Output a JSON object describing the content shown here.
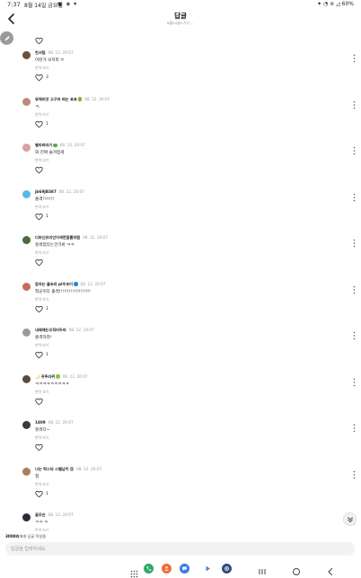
{
  "status_bar": {
    "time": "7:37",
    "date": "8월 14일 금요일",
    "battery": "60%"
  },
  "header": {
    "title": "답글",
    "subtitle": "8월14일8 기기 ..."
  },
  "comments": [
    {
      "user": "헌서팀",
      "date": "08. 12. 20:07",
      "text": "이런거 보지마 ㅠ",
      "translate": "번역 보기",
      "likes": "3",
      "avatar_color": "#6b4f3a",
      "badge": null
    },
    {
      "user": "뮤체비앗 고구마 찌는 표표",
      "date": "08. 12. 20:07",
      "text": "ㅋ,",
      "translate": "번역 보기",
      "likes": "1",
      "avatar_color": "#b98b7a",
      "badge": "#7cb342"
    },
    {
      "user": "별라바라기",
      "date": "08. 12. 20:07",
      "text": "와 진짜 슬겨첩게",
      "translate": "번역 보기",
      "likes": "",
      "avatar_color": "#d8a0a0",
      "badge": "#4caf50"
    },
    {
      "user": "jb69JB387",
      "date": "08. 12. 20:07",
      "text": "출격!!!!!!!",
      "translate": "번역 보기",
      "likes": "1",
      "avatar_color": "#5bb8e8",
      "badge": null
    },
    {
      "user": "디바신유리인어색한알름처럼",
      "date": "08. 12. 20:07",
      "text": "못씌었다는건가바 ㅋㅋ",
      "translate": "번역 보기",
      "likes": "",
      "avatar_color": "#4a6b3a",
      "badge": null
    },
    {
      "user": "잠자는 출속의 pl우초이",
      "date": "08. 12. 20:07",
      "text": "착군이다 출격!!!!!!!!!!!!!!!!!!!",
      "translate": "번역 보기",
      "likes": "1",
      "avatar_color": "#c96a5a",
      "badge": "#1e88e5"
    },
    {
      "user": "내배제는오직터두라",
      "date": "08. 12. 20:07",
      "text": "출격하라!",
      "translate": "번역 보기",
      "likes": "1",
      "avatar_color": "#9a9a9a",
      "badge": null
    },
    {
      "user": "🌙 귀뚜라뀌",
      "date": "08. 12. 20:07",
      "text": "ㅋㅋㅋㅋㅋㅋㅋㅋㅋ",
      "translate": "번역 보기",
      "likes": "",
      "avatar_color": "#5a4a3a",
      "badge": "#8bc34a"
    },
    {
      "user": "1409",
      "date": "08. 12. 20:07",
      "text": "못씌다~",
      "translate": "번역 보기",
      "likes": "",
      "avatar_color": "#3a3a3a",
      "badge": null
    },
    {
      "user": "나는 락스타 스텔남이",
      "date": "08. 12. 20:07",
      "text": "칠",
      "translate": "번역 보기",
      "likes": "1",
      "avatar_color": "#a88060",
      "badge": "#9e9e9e"
    },
    {
      "user": "골무은",
      "date": "08. 12. 20:07",
      "text": "ㅋㅋ ㅋ",
      "translate": "번역 보기",
      "likes": "",
      "avatar_color": "#2a2a3a",
      "badge": null
    }
  ],
  "reply": {
    "target_user": "3000리",
    "target_suffix": "에게 답글 작성중",
    "placeholder": "답글을 입력하세요."
  },
  "nav": {
    "apps": [
      {
        "name": "phone-app-icon",
        "color": "#2eaa6a"
      },
      {
        "name": "contacts-app-icon",
        "color": "#f26b3a"
      },
      {
        "name": "messages-app-icon",
        "color": "#3b7ce8"
      },
      {
        "name": "play-store-app-icon",
        "color": "#ffffff"
      },
      {
        "name": "settings-app-icon",
        "color": "#2f4f7f"
      }
    ]
  }
}
